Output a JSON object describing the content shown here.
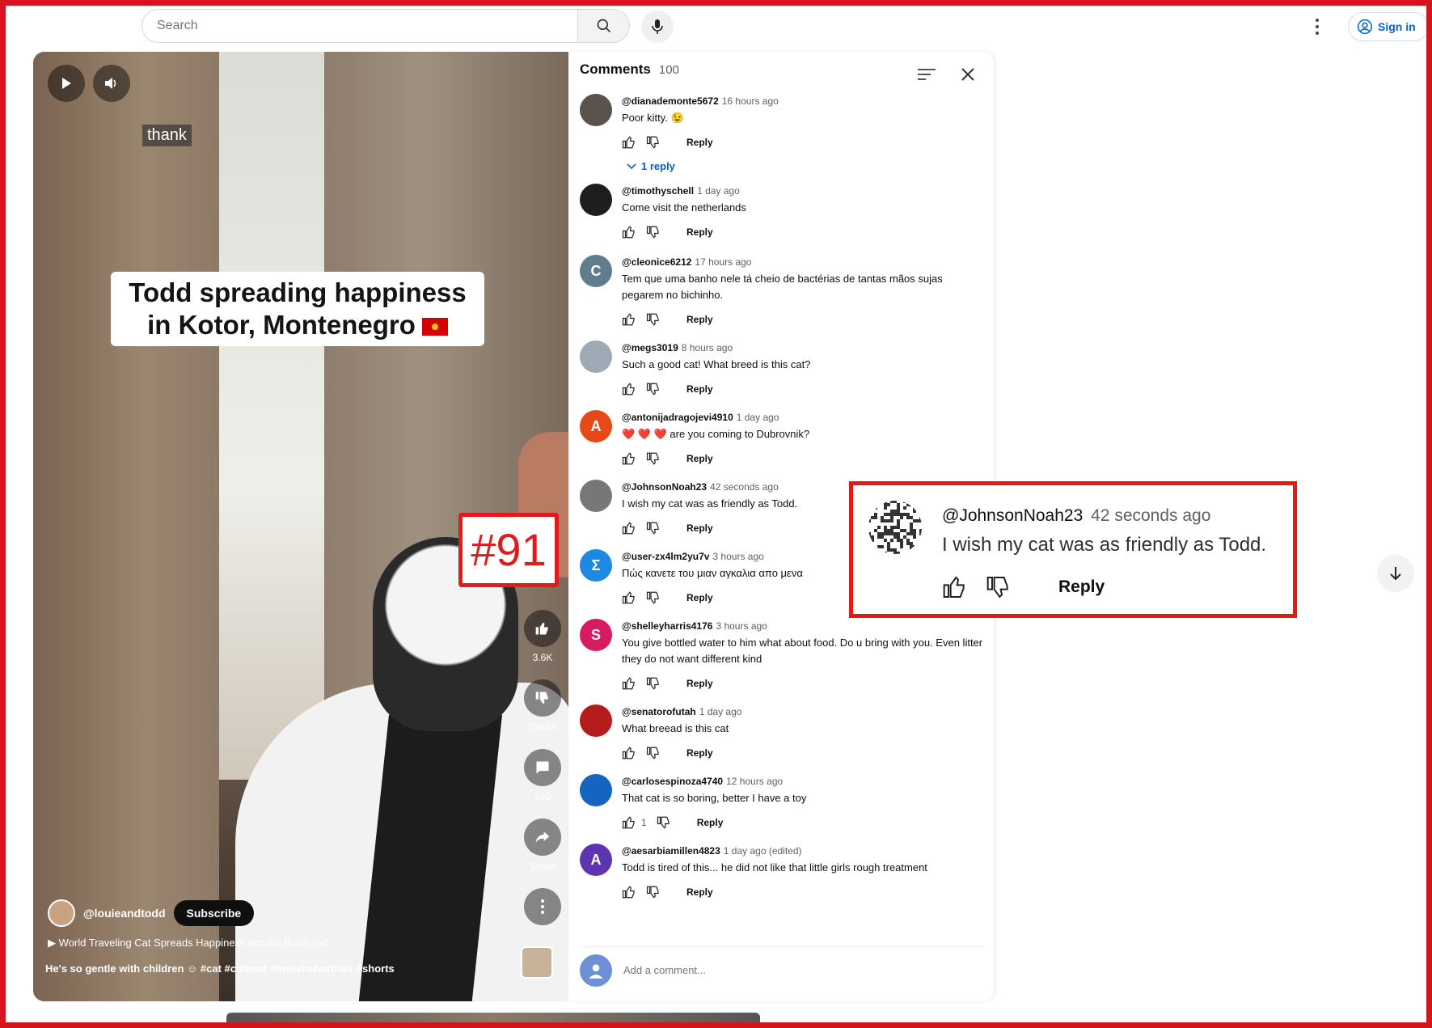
{
  "topbar": {
    "search_placeholder": "Search",
    "signin_label": "Sign in"
  },
  "video": {
    "thank_label": "thank",
    "overlay_title_line1": "Todd spreading happiness",
    "overlay_title_line2": "in Kotor, Montenegro",
    "side_actions": [
      {
        "icon": "like-icon",
        "label": "3.6K"
      },
      {
        "icon": "dislike-icon",
        "label": "Dislike"
      },
      {
        "icon": "comment-icon",
        "label": "100"
      },
      {
        "icon": "share-icon",
        "label": "Share"
      },
      {
        "icon": "more-icon",
        "label": ""
      }
    ],
    "channel_name": "@louieandtodd",
    "subscribe_label": "Subscribe",
    "playlist_label": "World Traveling Cat Spreads Happiness around Budapest",
    "playlist_suffix": "    ",
    "description": "He's so gentle with children ☺ #cat #cutecat #britishshorthair #shorts"
  },
  "comments_panel": {
    "title": "Comments",
    "count": "100",
    "reply_label": "Reply",
    "add_comment_placeholder": "Add a comment...",
    "items": [
      {
        "author": "@dianademonte5672",
        "time": "16 hours ago",
        "text": "Poor kitty. 😉",
        "replies": "1 reply",
        "avatar_color": "#5a534b",
        "initial": ""
      },
      {
        "author": "@timothyschell",
        "time": "1 day ago",
        "text": "Come visit the netherlands",
        "avatar_color": "#1e1e1e",
        "initial": ""
      },
      {
        "author": "@cleonice6212",
        "time": "17 hours ago",
        "text": "Tem que uma banho nele tá cheio de bactérias de tantas mãos sujas pegarem no bichinho.",
        "avatar_color": "#607d8b",
        "initial": "C"
      },
      {
        "author": "@megs3019",
        "time": "8 hours ago",
        "text": "Such a good cat! What breed is this cat?",
        "avatar_color": "#9fa8b5",
        "initial": ""
      },
      {
        "author": "@antonijadragojevi4910",
        "time": "1 day ago",
        "text": "❤️ ❤️ ❤️ are you coming to Dubrovnik?",
        "avatar_color": "#e64a19",
        "initial": "A"
      },
      {
        "author": "@JohnsonNoah23",
        "time": "42 seconds ago",
        "text": "I wish my cat was as friendly as Todd.",
        "avatar_color": "#777777",
        "initial": ""
      },
      {
        "author": "@user-zx4lm2yu7v",
        "time": "3 hours ago",
        "text": "Πώς κανετε του μιαν αγκαλια απο μενα",
        "avatar_color": "#1e88e5",
        "initial": "Σ"
      },
      {
        "author": "@shelleyharris4176",
        "time": "3 hours ago",
        "text": "You give bottled water to him what about food. Do u bring with you. Even litter they do not want different kind",
        "avatar_color": "#d81b60",
        "initial": "S"
      },
      {
        "author": "@senatorofutah",
        "time": "1 day ago",
        "text": "What breead is this cat",
        "avatar_color": "#b71c1c",
        "initial": ""
      },
      {
        "author": "@carlosespinoza4740",
        "time": "12 hours ago",
        "text": "That cat is so boring, better I have a toy",
        "like_count": "1",
        "avatar_color": "#1565c0",
        "initial": ""
      },
      {
        "author": "@aesarbiamillen4823",
        "time": "1 day ago (edited)",
        "text": "Todd is tired of this... he did not like that little girls rough treatment",
        "avatar_color": "#5e35b1",
        "initial": "A"
      }
    ]
  },
  "badge": {
    "label": "#91"
  },
  "callout": {
    "author": "@JohnsonNoah23",
    "time": "42 seconds ago",
    "text": "I wish my cat was as friendly as Todd.",
    "reply_label": "Reply"
  },
  "colors": {
    "highlight_red": "#e01b1b",
    "link_blue": "#065fd4"
  }
}
